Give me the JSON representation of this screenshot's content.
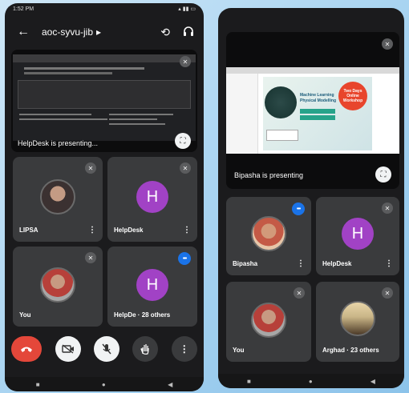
{
  "left": {
    "status_time": "1:52 PM",
    "meeting_code": "aoc-syvu-jib",
    "meeting_code_chevron": "▸",
    "presenting": "HelpDesk is presenting...",
    "tiles": [
      {
        "name": "LIPSA"
      },
      {
        "name": "HelpDesk",
        "initial": "H"
      },
      {
        "name": "You"
      },
      {
        "name": "HelpDe",
        "others": "28 others",
        "initial": "H"
      }
    ],
    "more_label": "⋮"
  },
  "right": {
    "presenting": "Bipasha is presenting",
    "tiles": [
      {
        "name": "Bipasha"
      },
      {
        "name": "HelpDesk",
        "initial": "H"
      },
      {
        "name": "You"
      },
      {
        "name": "Arghad",
        "others": "23 others"
      }
    ],
    "slide_lines": [
      "Two Days",
      "Online",
      "Workshop",
      "Machine Learning",
      "Physical Modelling"
    ]
  },
  "icons": {
    "back": "←",
    "switch_camera": "⟲",
    "headphones": "🎧",
    "mute": "✕",
    "end_call": "☎",
    "camera_off": "▣",
    "mic_off": "⊘",
    "raise_hand": "✋",
    "more": "⋮",
    "fullscreen": "⛶",
    "talking": "•••",
    "nav_square": "■",
    "nav_circle": "●",
    "nav_back": "◀"
  },
  "colors": {
    "end_call": "#e4473a",
    "avatar_purple": "#a142c5",
    "talk_blue": "#1a73e8",
    "tile_bg": "#3a3b3d"
  }
}
